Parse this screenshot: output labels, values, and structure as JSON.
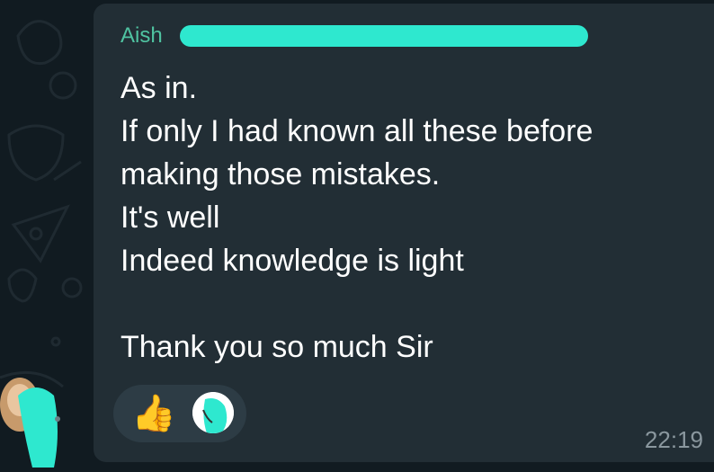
{
  "chat": {
    "sender_prefix": "Aish",
    "message_lines": [
      "As in.",
      "If only I had known all these before",
      "making those mistakes.",
      "It's well",
      "Indeed knowledge is light",
      "",
      "Thank you so much Sir"
    ],
    "timestamp": "22:19",
    "reaction_emoji": "👍"
  },
  "colors": {
    "background": "#111b21",
    "bubble": "#222e35",
    "sender_name": "#4fc3a1",
    "redaction": "#2ee8cf",
    "timestamp": "#8a979e"
  }
}
